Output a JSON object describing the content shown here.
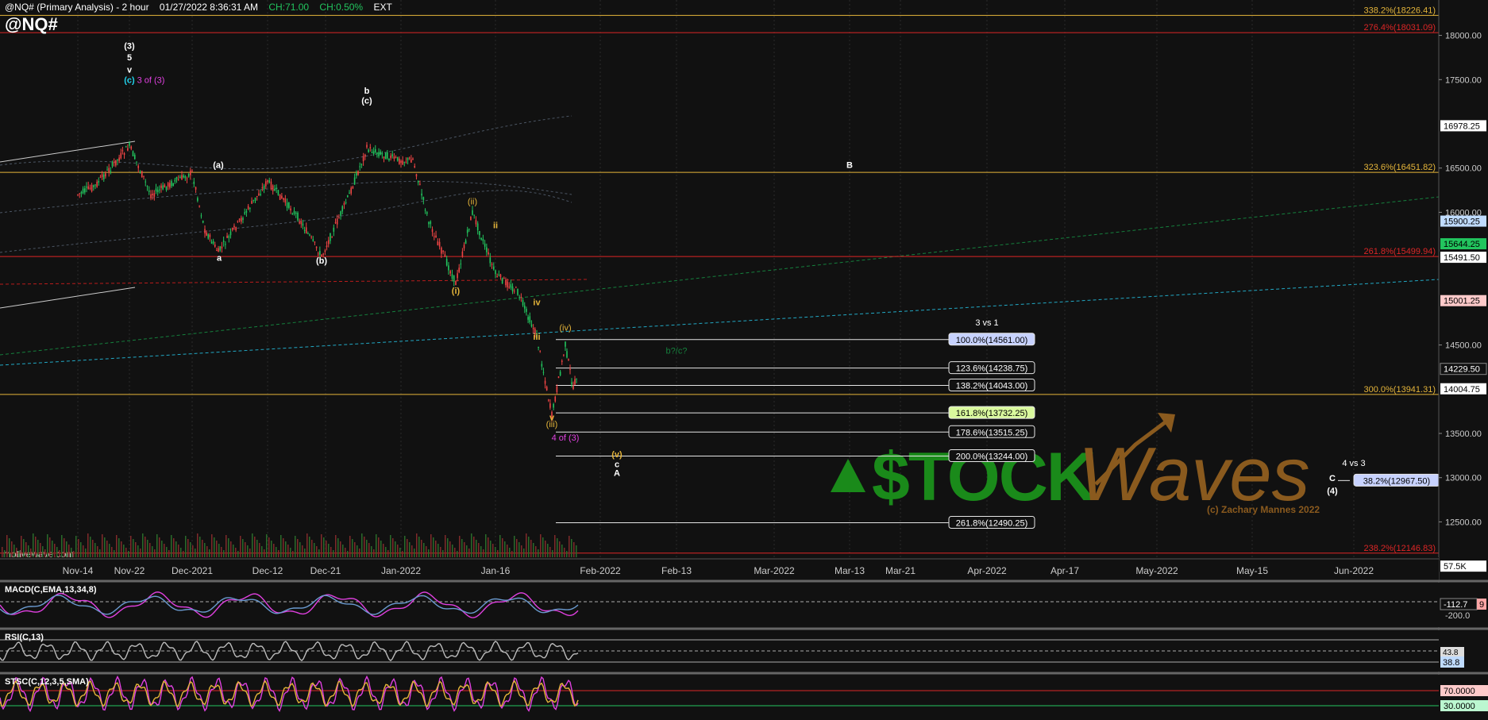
{
  "header": {
    "title": "@NQ# (Primary Analysis) - 2 hour",
    "datetime": "01/27/2022 8:36:31 AM",
    "change_abs": "CH:71.00",
    "change_pct": "CH:0.50%",
    "session": "EXT",
    "symbol": "@NQ#"
  },
  "watermark": {
    "brand": "motivewave.com",
    "logo_text": "StockWaves",
    "copyright": "(c) Zachary Mannes 2022"
  },
  "colors": {
    "background": "#111111",
    "up": "#22c55e",
    "down": "#ef4444",
    "gold": "#e5b53a",
    "red_line": "#dc2626",
    "magenta": "#e040e0",
    "logo_green": "#1a8a1a",
    "logo_brown": "#8a5a1e"
  },
  "chart_data": [
    {
      "type": "line",
      "name": "price",
      "x_ticks": [
        "Nov-14",
        "Nov-22",
        "Dec-2021",
        "Dec-12",
        "Dec-21",
        "Jan-2022",
        "Jan-16",
        "Feb-2022",
        "Feb-13",
        "Mar-2022",
        "Mar-13",
        "Mar-21",
        "Apr-2022",
        "Apr-17",
        "May-2022",
        "May-15",
        "Jun-2022"
      ],
      "y_ticks": [
        18000,
        17500,
        16500,
        16000,
        14500,
        13500,
        13000,
        12500
      ],
      "ylim": [
        12100,
        18400
      ],
      "price_path": [
        [
          "Nov-14",
          16200
        ],
        [
          "Nov-17",
          16300
        ],
        [
          "Nov-22",
          16750
        ],
        [
          "Nov-26",
          16200
        ],
        [
          "Dec-2021",
          16450
        ],
        [
          "Dec-4",
          15800
        ],
        [
          "Dec-8",
          15550
        ],
        [
          "Dec-12",
          16350
        ],
        [
          "Dec-16",
          15950
        ],
        [
          "Dec-20",
          15500
        ],
        [
          "Dec-24",
          16200
        ],
        [
          "Dec-27",
          16720
        ],
        [
          "Jan-2022",
          16580
        ],
        [
          "Jan-3",
          16600
        ],
        [
          "Jan-8",
          15900
        ],
        [
          "Jan-10",
          15200
        ],
        [
          "Jan-13",
          16000
        ],
        [
          "Jan-16",
          15300
        ],
        [
          "Jan-19",
          15100
        ],
        [
          "Jan-22",
          14600
        ],
        [
          "Jan-24",
          13700
        ],
        [
          "Jan-25",
          14500
        ],
        [
          "Jan-26",
          14000
        ],
        [
          "Jan-27",
          14230
        ]
      ],
      "current_price_label": "14229.50",
      "price_levels": [
        {
          "label": "338.2%(18226.41)",
          "value": 18226.41,
          "color": "#e5b53a"
        },
        {
          "label": "276.4%(18031.09)",
          "value": 18031.09,
          "color": "#dc2626"
        },
        {
          "label": "323.6%(16451.82)",
          "value": 16451.82,
          "color": "#e5b53a"
        },
        {
          "label": "261.8%(15499.94)",
          "value": 15499.94,
          "color": "#dc2626"
        },
        {
          "label": "300.0%(13941.31)",
          "value": 13941.31,
          "color": "#e5b53a"
        },
        {
          "label": "238.2%(12146.83)",
          "value": 12146.83,
          "color": "#dc2626"
        }
      ],
      "fib_targets": [
        {
          "label": "100.0%(14561.00)",
          "value": 14561.0,
          "highlight": "#c7d2fe"
        },
        {
          "label": "123.6%(14238.75)",
          "value": 14238.75,
          "highlight": ""
        },
        {
          "label": "138.2%(14043.00)",
          "value": 14043.0,
          "highlight": ""
        },
        {
          "label": "161.8%(13732.25)",
          "value": 13732.25,
          "highlight": "#d9f99d"
        },
        {
          "label": "178.6%(13515.25)",
          "value": 13515.25,
          "highlight": ""
        },
        {
          "label": "200.0%(13244.00)",
          "value": 13244.0,
          "highlight": ""
        },
        {
          "label": "261.8%(12490.25)",
          "value": 12490.25,
          "highlight": ""
        },
        {
          "label": "38.2%(12967.50)",
          "value": 12967.5,
          "highlight": "#c7d2fe"
        }
      ],
      "right_axis_badges": [
        {
          "label": "16978.25",
          "value": 16978.25,
          "bg": "#ffffff",
          "fg": "#000000"
        },
        {
          "label": "15900.25",
          "value": 15900.25,
          "bg": "#bfdbfe",
          "fg": "#000000"
        },
        {
          "label": "15644.25",
          "value": 15644.25,
          "bg": "#22c55e",
          "fg": "#000000"
        },
        {
          "label": "15491.50",
          "value": 15491.5,
          "bg": "#ffffff",
          "fg": "#000000"
        },
        {
          "label": "15001.25",
          "value": 15001.25,
          "bg": "#fecaca",
          "fg": "#000000"
        },
        {
          "label": "14004.75",
          "value": 14004.75,
          "bg": "#ffffff",
          "fg": "#000000"
        },
        {
          "label": "57.5K",
          "value": 12000,
          "bg": "#ffffff",
          "fg": "#000000"
        }
      ],
      "annotations": [
        {
          "text": "(3)",
          "x": "Nov-22",
          "y": 17850,
          "color": "#ffffff"
        },
        {
          "text": "5",
          "x": "Nov-22",
          "y": 17720,
          "color": "#ffffff"
        },
        {
          "text": "v",
          "x": "Nov-22",
          "y": 17580,
          "color": "#ffffff"
        },
        {
          "text": "(c)",
          "x": "Nov-22",
          "y": 17460,
          "color": "#22d3ee"
        },
        {
          "text": "3 of (3)",
          "x": "Nov-26",
          "y": 17460,
          "color": "#e040e0"
        },
        {
          "text": "(a)",
          "x": "Dec-8",
          "y": 16500,
          "color": "#ffffff"
        },
        {
          "text": "a",
          "x": "Dec-2",
          "y": 15450,
          "color": "#ffffff"
        },
        {
          "text": "(b)",
          "x": "Dec-20",
          "y": 15420,
          "color": "#ffffff"
        },
        {
          "text": "b",
          "x": "Dec-27",
          "y": 17340,
          "color": "#ffffff"
        },
        {
          "text": "(c)",
          "x": "Dec-27",
          "y": 17230,
          "color": "#ffffff"
        },
        {
          "text": "(ii)",
          "x": "Jan-13",
          "y": 16090,
          "color": "#e5b53a"
        },
        {
          "text": "(i)",
          "x": "Jan-10",
          "y": 15080,
          "color": "#e5b53a"
        },
        {
          "text": "ii",
          "x": "Jan-16",
          "y": 15820,
          "color": "#e5b53a"
        },
        {
          "text": "iv",
          "x": "Jan-22",
          "y": 14950,
          "color": "#e5b53a"
        },
        {
          "text": "iii",
          "x": "Jan-22",
          "y": 14560,
          "color": "#e5b53a"
        },
        {
          "text": "(iv)",
          "x": "Jan-25",
          "y": 14660,
          "color": "#e5b53a"
        },
        {
          "text": "v",
          "x": "Jan-24",
          "y": 13650,
          "color": "#e5b53a"
        },
        {
          "text": "(iii)",
          "x": "Jan-24",
          "y": 13570,
          "color": "#e5b53a"
        },
        {
          "text": "4 of (3)",
          "x": "Jan-25",
          "y": 13420,
          "color": "#e040e0"
        },
        {
          "text": "(v)",
          "x": "Jan-31",
          "y": 13230,
          "color": "#e5b53a"
        },
        {
          "text": "c",
          "x": "Jan-31",
          "y": 13120,
          "color": "#ffffff"
        },
        {
          "text": "A",
          "x": "Jan-31",
          "y": 13020,
          "color": "#ffffff"
        },
        {
          "text": "B",
          "x": "Mar-13",
          "y": 16500,
          "color": "#ffffff"
        },
        {
          "text": "3 vs 1",
          "x": "Apr-2022",
          "y": 14720,
          "color": "#ffffff"
        },
        {
          "text": "b?/c?",
          "x": "Feb-13",
          "y": 14400,
          "color": "#15803d"
        },
        {
          "text": "4 vs 3",
          "x": "Jun-2022",
          "y": 13130,
          "color": "#ffffff"
        },
        {
          "text": "C",
          "x": "May-31",
          "y": 12960,
          "color": "#ffffff"
        },
        {
          "text": "(4)",
          "x": "May-31",
          "y": 12820,
          "color": "#ffffff"
        }
      ]
    },
    {
      "type": "line",
      "name": "MACD",
      "title": "MACD(C,EMA,13,34,8)",
      "y_ticks": [
        -200.0
      ],
      "current_value_label": "-112.7",
      "overflow_label": "9"
    },
    {
      "type": "line",
      "name": "RSI",
      "title": "RSI(C,13)",
      "current_value_label": "38.8",
      "top_value_label": "43.8"
    },
    {
      "type": "line",
      "name": "Stochastic",
      "title": "STSC(C,12,3,5,SMA)",
      "levels": [
        {
          "label": "70.0000",
          "value": 70
        },
        {
          "label": "30.0000",
          "value": 30
        }
      ]
    }
  ]
}
